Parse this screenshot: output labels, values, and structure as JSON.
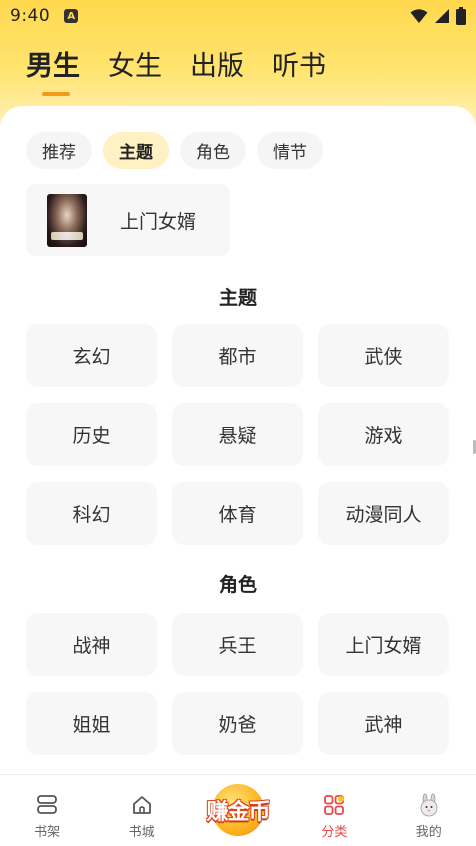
{
  "status_bar": {
    "time": "9:40",
    "app_badge": "A"
  },
  "gender_tabs": [
    {
      "label": "男生",
      "active": true
    },
    {
      "label": "女生",
      "active": false
    },
    {
      "label": "出版",
      "active": false
    },
    {
      "label": "听书",
      "active": false
    }
  ],
  "filter_chips": [
    {
      "label": "推荐",
      "active": false
    },
    {
      "label": "主题",
      "active": true
    },
    {
      "label": "角色",
      "active": false
    },
    {
      "label": "情节",
      "active": false
    }
  ],
  "featured": {
    "title": "上门女婿"
  },
  "sections": {
    "theme": {
      "title": "主题",
      "items": [
        "玄幻",
        "都市",
        "武侠",
        "历史",
        "悬疑",
        "游戏",
        "科幻",
        "体育",
        "动漫同人"
      ]
    },
    "role": {
      "title": "角色",
      "items": [
        "战神",
        "兵王",
        "上门女婿",
        "姐姐",
        "奶爸",
        "武神"
      ]
    }
  },
  "bottom_nav": [
    {
      "label": "书架",
      "icon": "bookshelf-icon",
      "active": false
    },
    {
      "label": "书城",
      "icon": "home-icon",
      "active": false
    },
    {
      "label": "赚金币",
      "icon": "coin-icon",
      "active": false
    },
    {
      "label": "分类",
      "icon": "category-icon",
      "active": true
    },
    {
      "label": "我的",
      "icon": "avatar-icon",
      "active": false
    }
  ],
  "colors": {
    "accent_orange": "#f39a1a",
    "active_red": "#e8484a",
    "header_yellow": "#ffd84e",
    "chip_active_bg": "#fff1c4"
  }
}
